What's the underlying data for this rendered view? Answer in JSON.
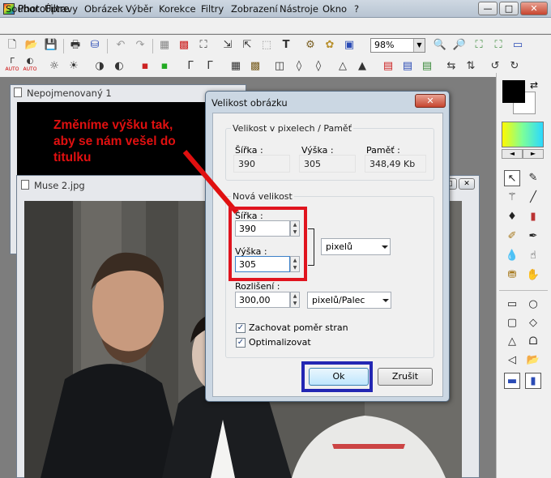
{
  "app": {
    "title": "PhotoFiltre",
    "minimize": "—",
    "maximize": "□",
    "close": "✕"
  },
  "menu": [
    "Soubor",
    "Úpravy",
    "Obrázek",
    "Výběr",
    "Korekce",
    "Filtry",
    "Zobrazení",
    "Nástroje",
    "Okno",
    "?"
  ],
  "toolbar": {
    "zoom": "98%",
    "auto1": "AUTO",
    "auto2": "AUTO"
  },
  "windows": {
    "doc1_title": "Nepojmenovaný 1",
    "doc2_title": "Muse 2.jpg",
    "ctrl_min": "—",
    "ctrl_max": "□",
    "ctrl_close": "✕"
  },
  "annotation": {
    "line1": "Změníme výšku tak,",
    "line2": "aby se nám vešel do",
    "line3": "titulku"
  },
  "dialog": {
    "title": "Velikost obrázku",
    "close": "✕",
    "pixel_group": "Velikost v pixelech / Paměť",
    "width_label": "Šířka :",
    "height_label": "Výška :",
    "memory_label": "Paměť :",
    "width_value": "390",
    "height_value": "305",
    "memory_value": "348,49 Kb",
    "new_group": "Nová velikost",
    "new_width_label": "Šířka :",
    "new_width_value": "390",
    "new_height_label": "Výška :",
    "new_height_value": "305",
    "unit": "pixelů",
    "resolution_label": "Rozlišení :",
    "resolution_value": "300,00",
    "resolution_unit": "pixelů/Palec",
    "keep_ratio": "Zachovat poměr stran",
    "optimize": "Optimalizovat",
    "ok": "Ok",
    "cancel": "Zrušit"
  },
  "palette": {
    "swap": "⇄",
    "arrow_left": "◄",
    "arrow_right": "►"
  },
  "colors": {
    "annotation_red": "#e01010",
    "highlight_red": "#e0141e",
    "highlight_blue": "#2327b3"
  }
}
